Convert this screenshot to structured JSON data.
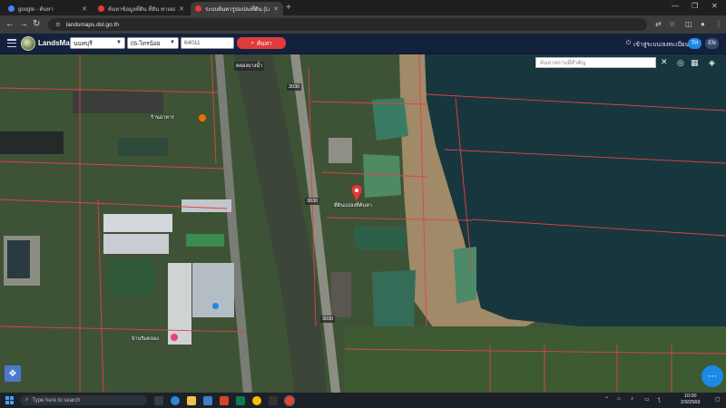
{
  "browser": {
    "tabs": [
      {
        "title": "google - ค้นหา",
        "favicon_color": "#4285f4",
        "active": false
      },
      {
        "title": "ค้นหาข้อมูลที่ดิน ที่ดิน ทางออนไลน์...",
        "favicon_color": "#e53935",
        "active": false
      },
      {
        "title": "ระบบค้นหารูปแปลงที่ดิน (LandsMa...",
        "favicon_color": "#e53935",
        "active": true
      }
    ],
    "new_tab": "+",
    "url": "landsmaps.dol.go.th",
    "window_controls": {
      "minimize": "—",
      "maximize": "❐",
      "close": "✕"
    }
  },
  "site": {
    "brand": "LandsMaps",
    "province": "นนทบุรี",
    "district": "05-ไทรน้อย",
    "parcel_number": "64011",
    "search_label": "ค้นหา",
    "login_label": "เข้าสู่ระบบ/ลงทะเบียน",
    "lang_th": "TH",
    "lang_en": "EN"
  },
  "map": {
    "search_placeholder": "ค้นหาสถานที่สำคัญ",
    "close": "✕",
    "road_labels": [
      "3030",
      "3030",
      "3030"
    ],
    "top_road_label": "คลองบางน้ำ",
    "parcel_label": "ที่ดินแปลงที่ค้นหา",
    "place_label_1": "ร้านอาหาร",
    "place_label_2": "บ้านริมคลอง",
    "fab_icon": "more-icon",
    "colors": {
      "parcel_line": "#e0424a",
      "marker": "#e53935",
      "water_lake": "#16373f",
      "canal": "#3f4a3d"
    }
  },
  "taskbar": {
    "search_placeholder": "Type here to search",
    "time": "10:00",
    "date": "2/9/2569"
  }
}
